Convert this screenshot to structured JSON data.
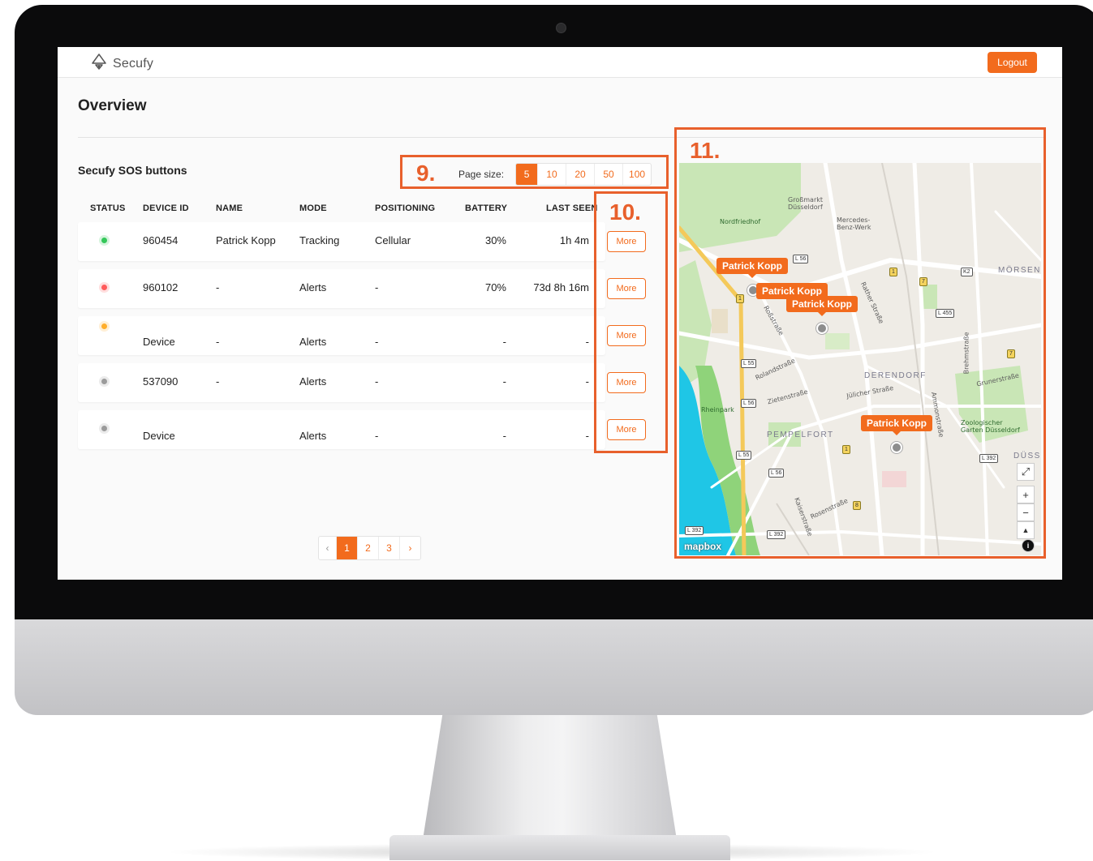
{
  "app": {
    "name": "Secufy"
  },
  "header": {
    "logout_label": "Logout"
  },
  "page": {
    "title": "Overview"
  },
  "section": {
    "title": "Secufy SOS buttons"
  },
  "page_size": {
    "label": "Page size:",
    "options": [
      "5",
      "10",
      "20",
      "50",
      "100"
    ],
    "selected": "5"
  },
  "table": {
    "columns": [
      "STATUS",
      "DEVICE ID",
      "NAME",
      "MODE",
      "POSITIONING",
      "BATTERY",
      "LAST SEEN"
    ],
    "rows": [
      {
        "status_color": "#34c759",
        "device_id": "960454",
        "name": "Patrick Kopp",
        "mode": "Tracking",
        "positioning": "Cellular",
        "battery": "30%",
        "last_seen": "1h 4m",
        "action": "More"
      },
      {
        "status_color": "#ff5a5a",
        "device_id": "960102",
        "name": "-",
        "mode": "Alerts",
        "positioning": "-",
        "battery": "70%",
        "last_seen": "73d 8h 16m",
        "action": "More"
      },
      {
        "status_color": "#ffae2b",
        "device_id": "Device",
        "name": "-",
        "mode": "Alerts",
        "positioning": "-",
        "battery": "-",
        "last_seen": "-",
        "action": "More"
      },
      {
        "status_color": "#9b9b9b",
        "device_id": "537090",
        "name": "-",
        "mode": "Alerts",
        "positioning": "-",
        "battery": "-",
        "last_seen": "-",
        "action": "More"
      },
      {
        "status_color": "#9b9b9b",
        "device_id": "Device",
        "name": "",
        "mode": "Alerts",
        "positioning": "-",
        "battery": "-",
        "last_seen": "-",
        "action": "More"
      }
    ]
  },
  "pagination": {
    "prev": "‹",
    "pages": [
      "1",
      "2",
      "3"
    ],
    "current": "1",
    "next": "›"
  },
  "callouts": [
    "9.",
    "10.",
    "11."
  ],
  "map": {
    "markers": [
      "Patrick Kopp",
      "Patrick Kopp",
      "Patrick Kopp",
      "Patrick Kopp"
    ],
    "places": [
      "Großmarkt Düsseldorf",
      "Nordfriedhof",
      "Mercedes-Benz-Werk",
      "MÖRSEN",
      "DERENDORF",
      "PEMPELFORT",
      "Rheinpark",
      "Zoologischer Garten Düsseldorf",
      "DÜSS",
      "Rolandstraße",
      "Zietenstraße",
      "Jülicher Straße",
      "Grunerstraße",
      "Kaiserstraße",
      "Roßstraße",
      "Rather Straße",
      "Brehmstraße",
      "Rosenstraße",
      "Ammonstraße"
    ],
    "road_badges": [
      "L 56",
      "1",
      "7",
      "K2",
      "L 455",
      "1",
      "7",
      "L 55",
      "L 56",
      "1",
      "L 55",
      "L 56",
      "8",
      "L 392",
      "L 392",
      "L 392"
    ],
    "attribution": "mapbox",
    "controls": [
      "expand-icon",
      "+",
      "−",
      "▲",
      "i"
    ]
  },
  "colors": {
    "accent": "#f26b1d",
    "callout": "#e8602c",
    "water": "#1fc6e6",
    "park": "#b7e1a1"
  }
}
